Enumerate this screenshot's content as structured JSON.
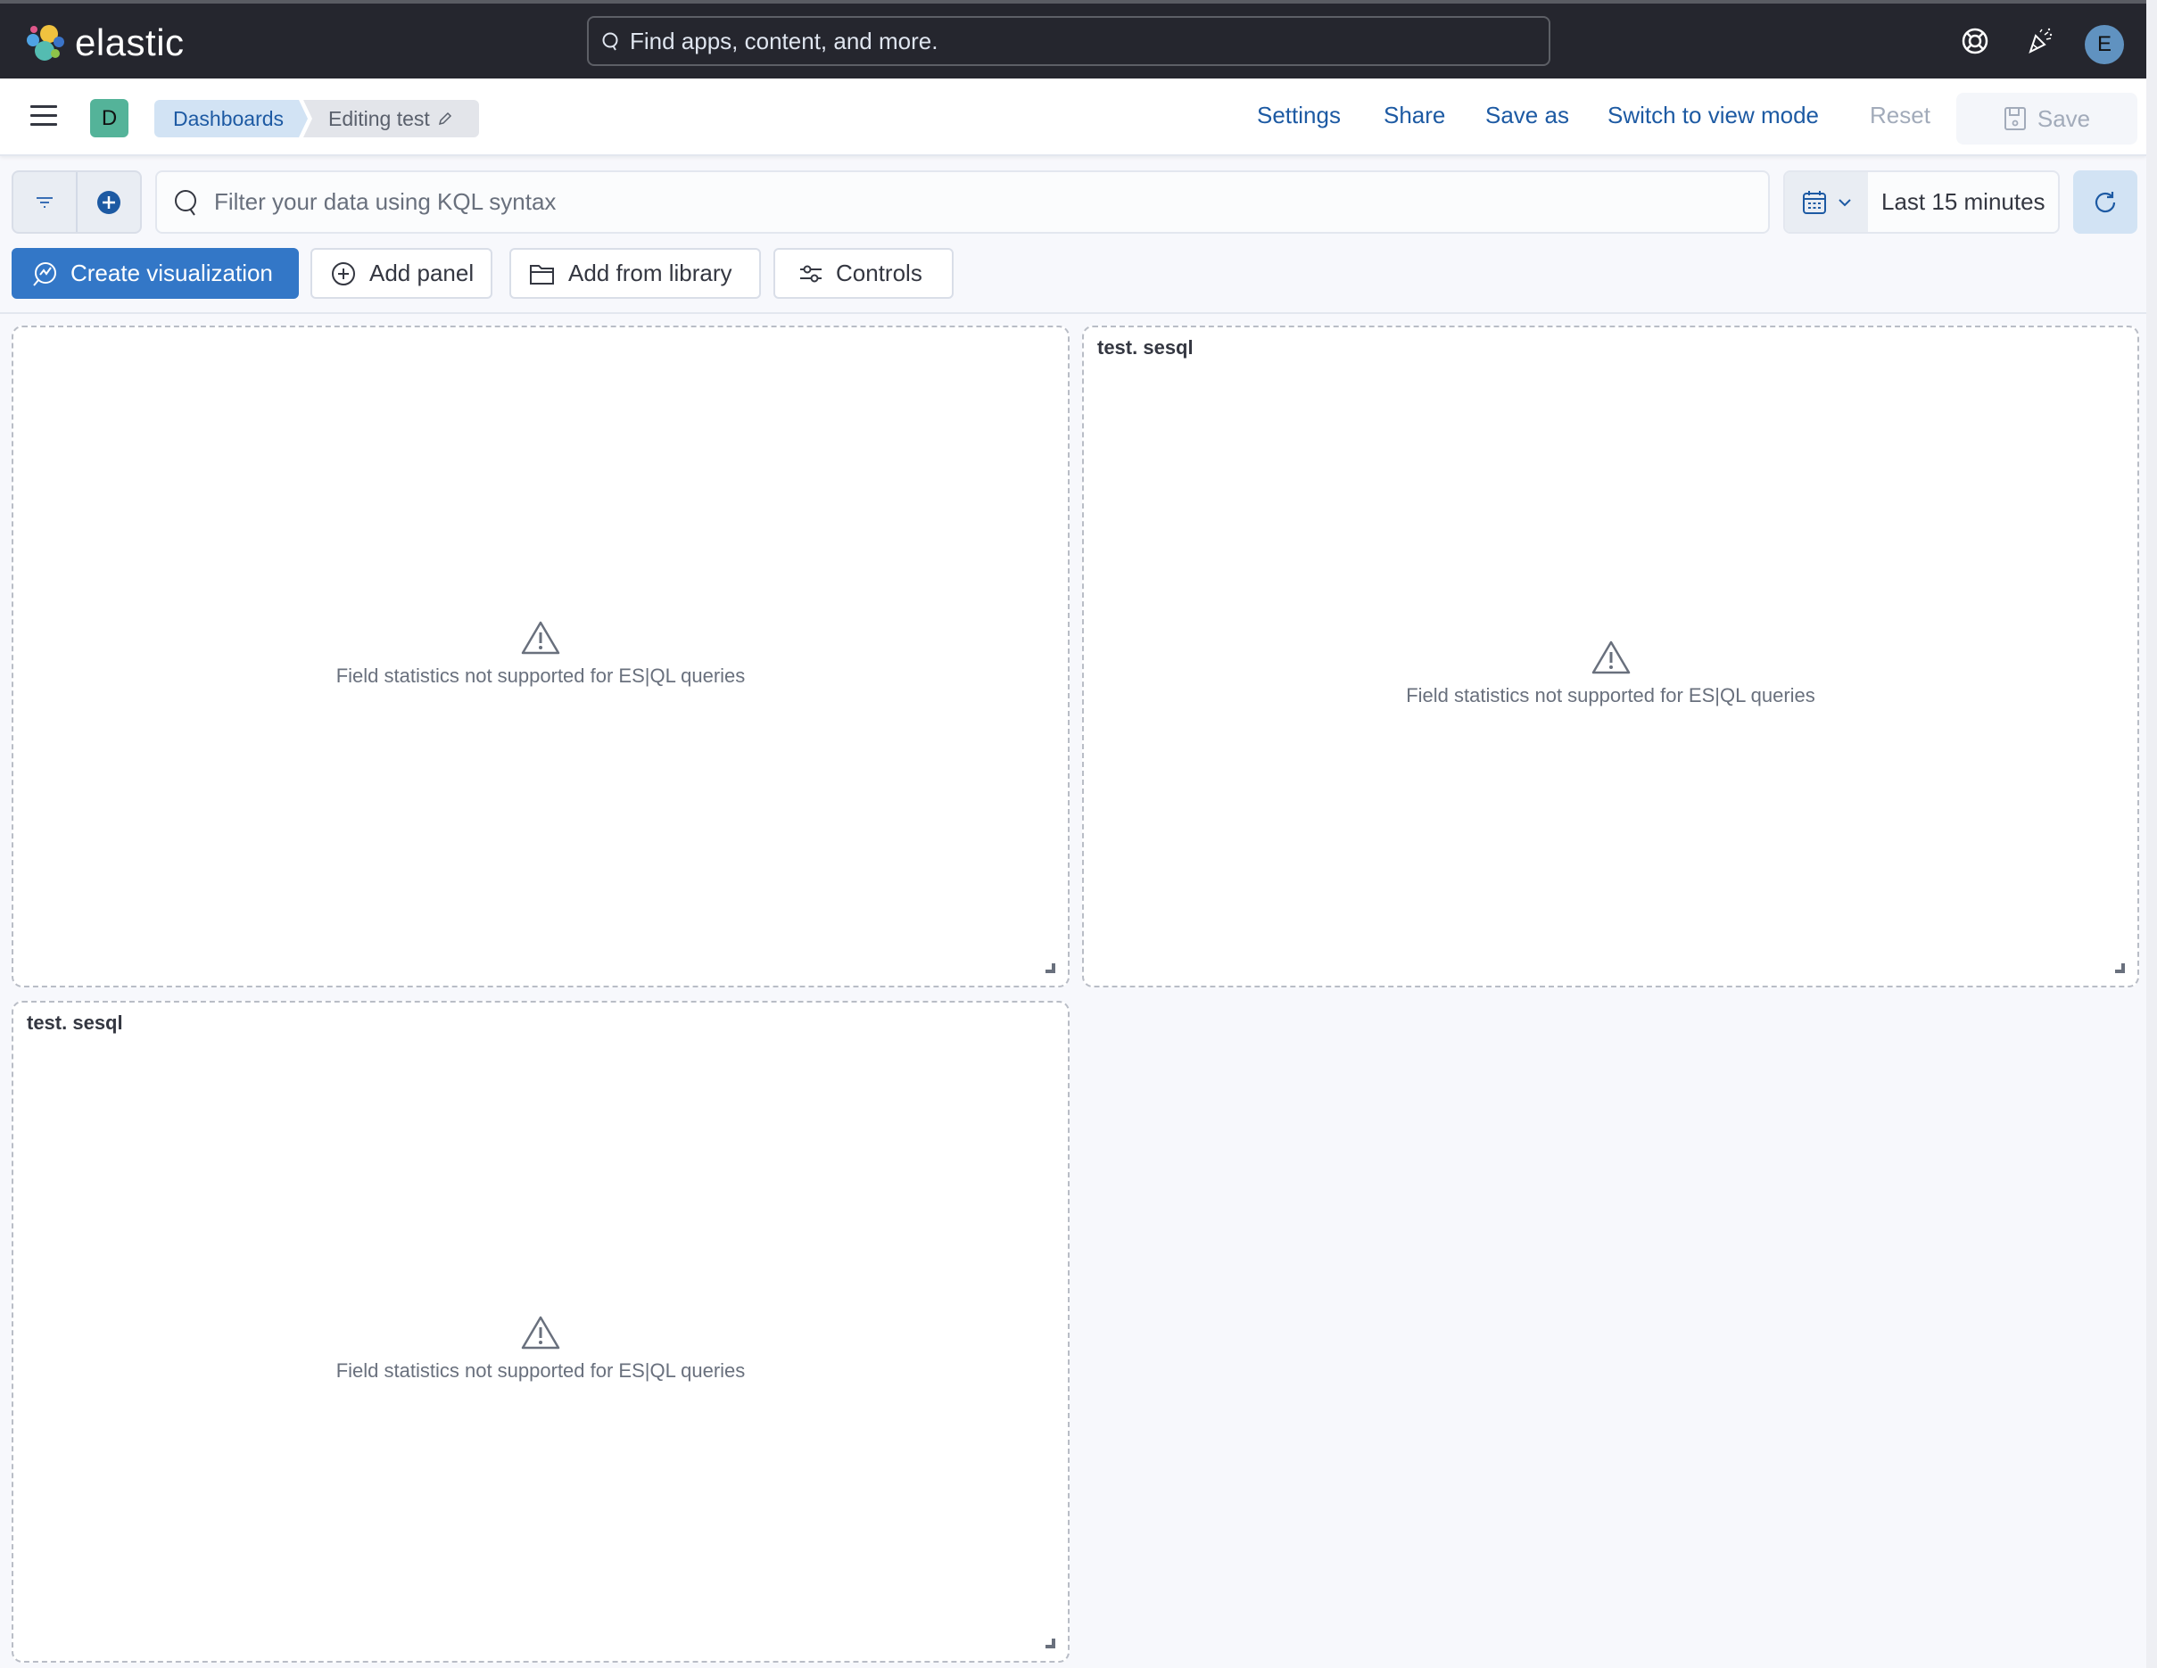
{
  "header": {
    "brand": "elastic",
    "search_placeholder": "Find apps, content, and more.",
    "icons": [
      "help-lifebuoy-icon",
      "news-celebration-icon"
    ],
    "user_initial": "E"
  },
  "breadcrumb_bar": {
    "space_initial": "D",
    "crumbs": [
      {
        "label": "Dashboards"
      },
      {
        "label": "Editing test"
      }
    ],
    "actions": {
      "settings": "Settings",
      "share": "Share",
      "save_as": "Save as",
      "switch_view": "Switch to view mode",
      "reset": "Reset",
      "save": "Save"
    }
  },
  "query_bar": {
    "kql_placeholder": "Filter your data using KQL syntax",
    "time_range": "Last 15 minutes"
  },
  "toolbar": {
    "create_visualization": "Create visualization",
    "add_panel": "Add panel",
    "add_from_library": "Add from library",
    "controls": "Controls"
  },
  "panels": [
    {
      "title": "",
      "message": "Field statistics not supported for ES|QL queries"
    },
    {
      "title": "test. sesql",
      "message": "Field statistics not supported for ES|QL queries"
    },
    {
      "title": "test. sesql",
      "message": "Field statistics not supported for ES|QL queries"
    }
  ],
  "colors": {
    "header_bg": "#25262e",
    "primary": "#3377c7",
    "link": "#1d5aa3",
    "disabled": "#a2abba"
  }
}
